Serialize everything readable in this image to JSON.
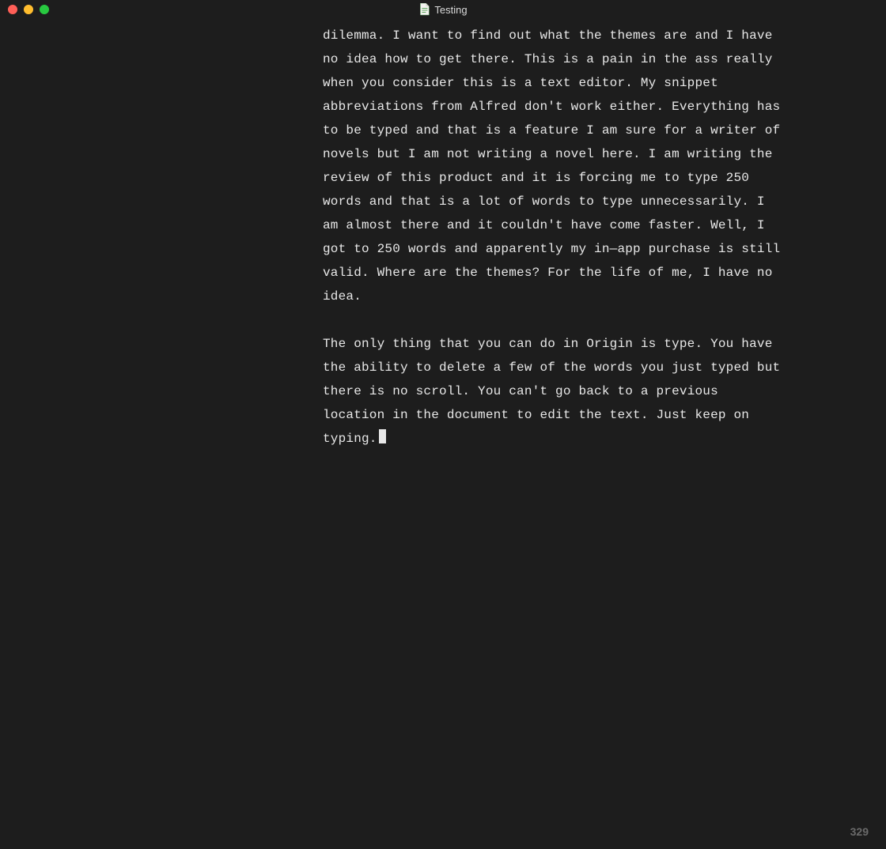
{
  "window": {
    "title": "Testing"
  },
  "document": {
    "paragraph_1": "dilemma. I want to find out what the themes are and I have no idea how to get there. This is a pain in the ass really when you consider this is a text editor. My snippet abbreviations from Alfred don't work either. Everything has to be typed and that is a feature I am sure for a writer of novels but I am not writing a novel here. I am writing the review of this product and it is forcing me to type 250 words and that is a lot of words to type unnecessarily. I am almost there and it couldn't have come faster. Well, I got to 250 words and apparently my in—app purchase is still valid. Where are the themes? For the life of me, I have no idea.",
    "paragraph_2": "The only thing that you can do in Origin is type. You have the ability to delete a few of the words you just typed but there is no scroll. You can't go back to a previous location in the document to edit the text. Just keep on typing."
  },
  "status": {
    "word_count": "329"
  }
}
